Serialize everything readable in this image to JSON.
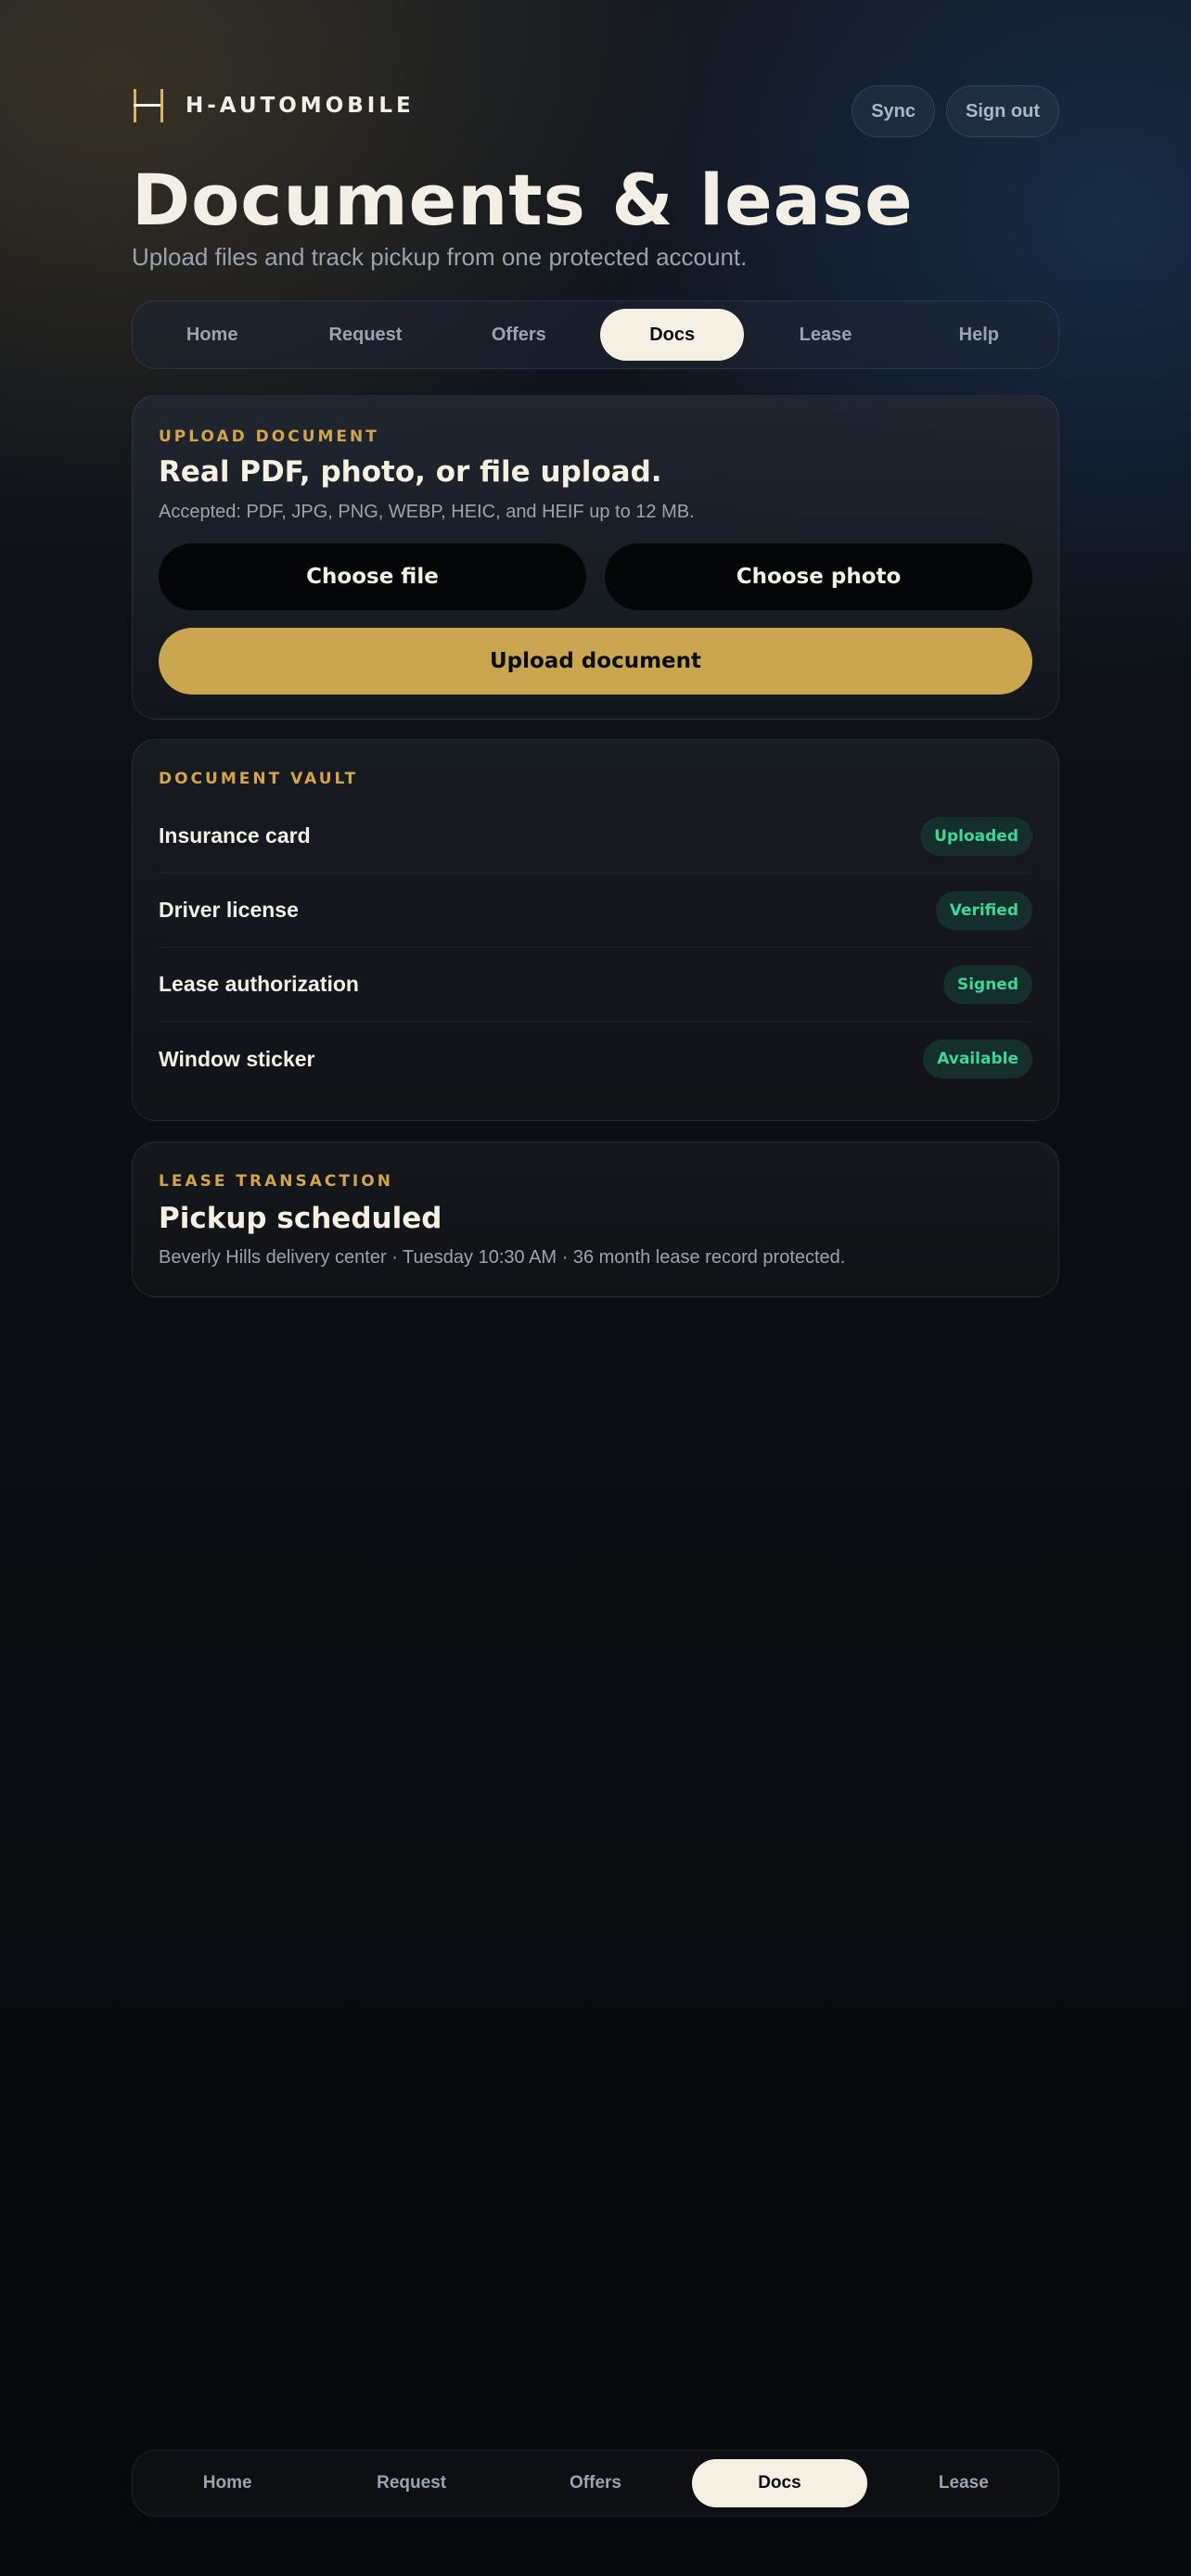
{
  "brand": {
    "name": "H-AUTOMOBILE",
    "logo_icon": "h-logo-icon"
  },
  "header": {
    "sync_label": "Sync",
    "signout_label": "Sign out"
  },
  "page": {
    "title": "Documents & lease",
    "subtitle": "Upload files and track pickup from one protected account."
  },
  "top_nav": {
    "tabs": [
      {
        "label": "Home"
      },
      {
        "label": "Request"
      },
      {
        "label": "Offers"
      },
      {
        "label": "Docs"
      },
      {
        "label": "Lease"
      },
      {
        "label": "Help"
      }
    ],
    "active": "Docs"
  },
  "upload": {
    "eyebrow": "UPLOAD DOCUMENT",
    "title": "Real PDF, photo, or file upload.",
    "accepted": "Accepted: PDF, JPG, PNG, WEBP, HEIC, and HEIF up to 12 MB.",
    "choose_file": "Choose file",
    "choose_photo": "Choose photo",
    "upload_button": "Upload document"
  },
  "vault": {
    "eyebrow": "DOCUMENT VAULT",
    "items": [
      {
        "name": "Insurance card",
        "status": "Uploaded"
      },
      {
        "name": "Driver license",
        "status": "Verified"
      },
      {
        "name": "Lease authorization",
        "status": "Signed"
      },
      {
        "name": "Window sticker",
        "status": "Available"
      }
    ]
  },
  "lease": {
    "eyebrow": "LEASE TRANSACTION",
    "title": "Pickup scheduled",
    "detail": "Beverly Hills delivery center · Tuesday 10:30 AM · 36 month lease record protected."
  },
  "bottom_nav": {
    "tabs": [
      {
        "label": "Home"
      },
      {
        "label": "Request"
      },
      {
        "label": "Offers"
      },
      {
        "label": "Docs"
      },
      {
        "label": "Lease"
      }
    ],
    "active": "Docs"
  },
  "colors": {
    "accent_gold": "#c9a64f",
    "eyebrow_gold": "#d2a54a",
    "cream": "#f5f0e2",
    "status_green": "#3fd699",
    "background": "#07090d"
  }
}
